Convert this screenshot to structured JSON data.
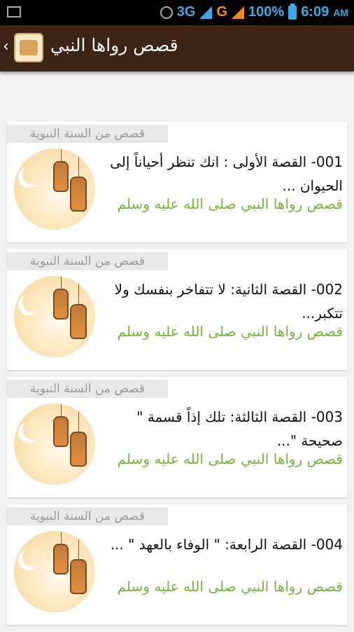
{
  "status": {
    "network1": "3G",
    "network2": "G",
    "battery": "100%",
    "time": "6:09",
    "ampm": "AM"
  },
  "appbar": {
    "title": "قصص رواها النبي"
  },
  "stories": [
    {
      "category": "قصص من السنة النبوية",
      "title": "001- القصة الأولى : انك تنظر أحياناً إلى الحيوان ...",
      "subtitle": "قصص رواها النبي صلى الله عليه وسلم"
    },
    {
      "category": "قصص من السنة النبوية",
      "title": "002- القصة الثانية: لا تتفاخر بنفسك ولا تتكبر...",
      "subtitle": "قصص رواها النبي صلى الله عليه وسلم"
    },
    {
      "category": "قصص من السنة النبوية",
      "title": "003- القصة الثالثة: تلك إذاً قسمة \" صحيحة \"...",
      "subtitle": "قصص رواها النبي صلى الله عليه وسلم"
    },
    {
      "category": "قصص من السنة النبوية",
      "title": "004- القصة الرابعة: \" الوفاء بالعهد \" ...",
      "subtitle": "قصص رواها النبي صلى الله عليه وسلم"
    }
  ]
}
